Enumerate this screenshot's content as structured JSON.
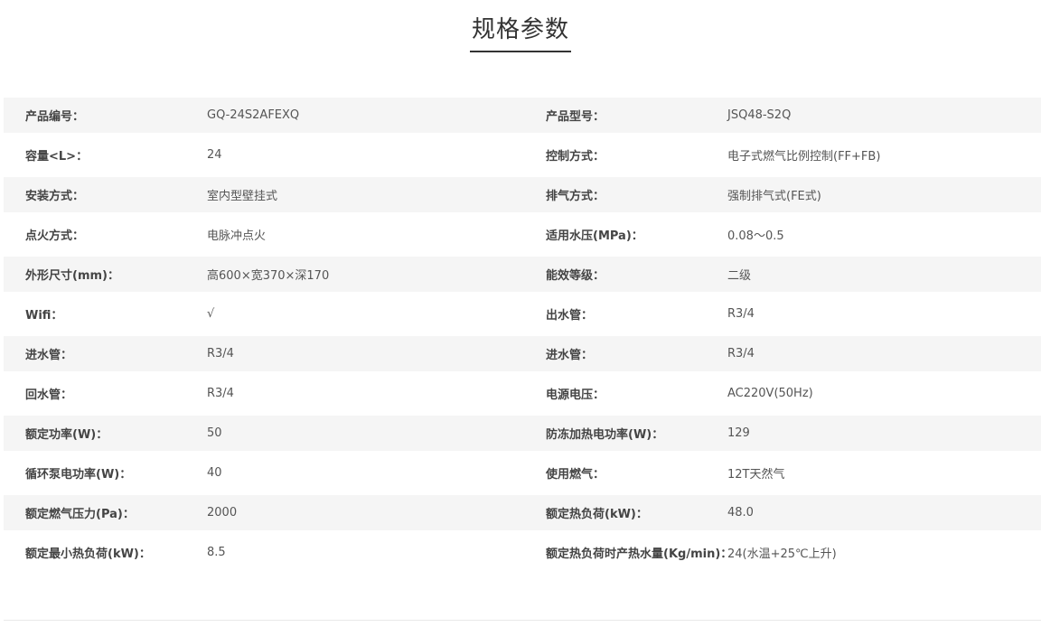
{
  "title": "规格参数",
  "rows": [
    {
      "l1": "产品编号：",
      "v1": "GQ-24S2AFEXQ",
      "l2": "产品型号：",
      "v2": "JSQ48-S2Q"
    },
    {
      "l1": "容量<L>：",
      "v1": "24",
      "l2": "控制方式：",
      "v2": "电子式燃气比例控制(FF+FB)"
    },
    {
      "l1": "安装方式：",
      "v1": "室内型壁挂式",
      "l2": "排气方式：",
      "v2": "强制排气式(FE式)"
    },
    {
      "l1": "点火方式：",
      "v1": "电脉冲点火",
      "l2": "适用水压(MPa)：",
      "v2": "0.08～0.5"
    },
    {
      "l1": "外形尺寸(mm)：",
      "v1": "高600×宽370×深170",
      "l2": "能效等级：",
      "v2": "二级"
    },
    {
      "l1": "Wifi：",
      "v1": "√",
      "l2": "出水管：",
      "v2": "R3/4"
    },
    {
      "l1": "进水管：",
      "v1": "R3/4",
      "l2": "进水管：",
      "v2": "R3/4"
    },
    {
      "l1": "回水管：",
      "v1": "R3/4",
      "l2": "电源电压：",
      "v2": "AC220V(50Hz)"
    },
    {
      "l1": "额定功率(W)：",
      "v1": "50",
      "l2": "防冻加热电功率(W)：",
      "v2": "129"
    },
    {
      "l1": "循环泵电功率(W)：",
      "v1": "40",
      "l2": "使用燃气：",
      "v2": "12T天然气"
    },
    {
      "l1": "额定燃气压力(Pa)：",
      "v1": "2000",
      "l2": "额定热负荷(kW)：",
      "v2": "48.0"
    },
    {
      "l1": "额定最小热负荷(kW)：",
      "v1": "8.5",
      "l2": "额定热负荷时产热水量(Kg/min)：",
      "v2": "24(水温+25℃上升)"
    }
  ]
}
